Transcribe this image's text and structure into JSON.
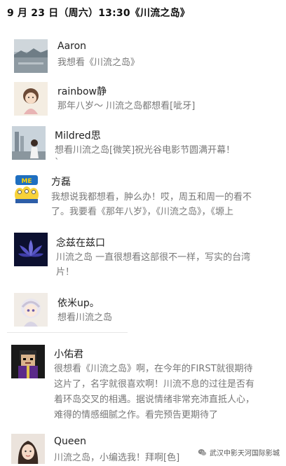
{
  "header": {
    "title": "9 月 23 日（周六）13:30《川流之岛》"
  },
  "comments": [
    {
      "avatar": "lake-avatar",
      "name": "Aaron",
      "lines": [
        "我想看《川流之岛》"
      ]
    },
    {
      "avatar": "cartoon-girl-avatar",
      "name": "rainbow静",
      "lines": [
        "那年八岁～ 川流之岛都想看[呲牙]"
      ]
    },
    {
      "avatar": "city-photo-avatar",
      "name": "Mildred思",
      "lines": [
        "想看川流之岛[微笑]祝光谷电影节圆满开幕！",
        "`"
      ]
    },
    {
      "avatar": "minions-avatar",
      "name": "方磊",
      "lines": [
        "我想说我都想看，肿么办！哎，周五和周一的看不",
        "了。我要看《那年八岁》，《川流之岛》，《塬上"
      ]
    },
    {
      "avatar": "lotus-avatar",
      "name": "念兹在兹口",
      "lines": [
        "川流之岛 一直很想看这部很不一样，写实的台湾",
        "片！"
      ]
    },
    {
      "avatar": "anime-girl-avatar",
      "name": "依米up。",
      "lines": [
        "想看川流之岛"
      ]
    },
    {
      "avatar": "pixel-character-avatar",
      "name": "小佑君",
      "lines": [
        "很想看《川流之岛》啊，在今年的FIRST就很期待",
        "这片了，名字就很喜欢啊！川流不息的过往是否有",
        "着环岛交叉的相遇。据说情绪非常充沛直抵人心，",
        "难得的情感细腻之作。看完预告更期待了"
      ]
    },
    {
      "avatar": "woman-photo-avatar",
      "name": "Queen",
      "lines": [
        "川流之岛，小编选我！拜啊[色]"
      ]
    }
  ],
  "watermark": {
    "text": "武汉中影天河国际影城",
    "icon": "wechat-icon"
  }
}
